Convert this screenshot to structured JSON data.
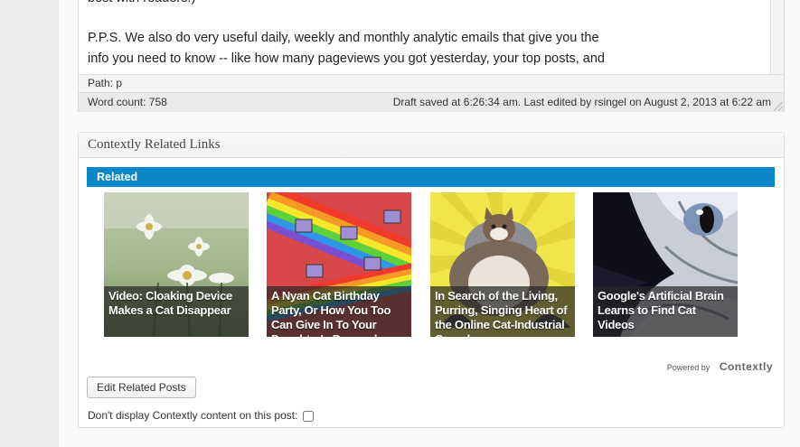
{
  "editor": {
    "text_line_top": "best with readers.)",
    "paragraph_ps_line1": "P.P.S. We also do very useful daily, weekly and monthly analytic emails that give you the",
    "paragraph_ps_line2": "info you need to know -- like how many pageviews you got yesterday, your top posts, and",
    "path_label": "Path: p",
    "word_count": "Word count: 758",
    "draft_status": "Draft saved at 6:26:34 am. Last edited by rsingel on August 2, 2013 at 6:22 am"
  },
  "contextly": {
    "title": "Contextly Related Links",
    "related_label": "Related",
    "cards": [
      {
        "caption": "Video: Cloaking Device Makes a Cat Disappear",
        "thumb": "daisy-field"
      },
      {
        "caption": "A Nyan Cat Birthday Party, Or How You Too Can Give In To Your Daughter's Demands",
        "thumb": "nyan-cat-streamers"
      },
      {
        "caption": "In Search of the Living, Purring, Singing Heart of the Online Cat-Industrial Complex",
        "thumb": "fluffy-cat"
      },
      {
        "caption": "Google's Artificial Brain Learns to Find Cat Videos",
        "thumb": "cat-face-closeup"
      }
    ],
    "powered_by": "Powered by",
    "brand": "Contextly",
    "edit_button": "Edit Related Posts",
    "dont_display_label": "Don't display Contextly content on this post:"
  },
  "colors": {
    "related_bar": "#0a86c9"
  }
}
